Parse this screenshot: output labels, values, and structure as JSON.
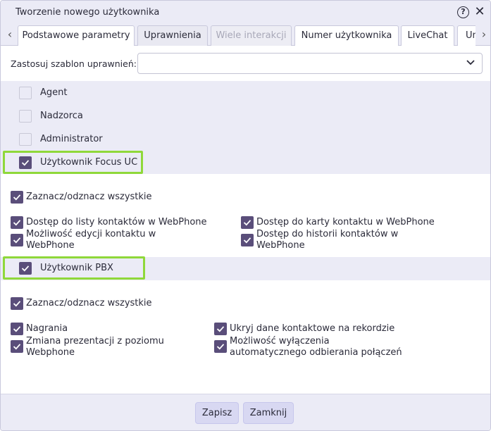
{
  "dialog": {
    "title": "Tworzenie nowego użytkownika",
    "help_icon": "help-circle-icon",
    "close_icon": "close-icon"
  },
  "tabs": [
    {
      "label": "Podstawowe parametry",
      "state": "active"
    },
    {
      "label": "Uprawnienia",
      "state": "normal"
    },
    {
      "label": "Wiele interakcji",
      "state": "disabled"
    },
    {
      "label": "Numer użytkownika",
      "state": "normal"
    },
    {
      "label": "LiveChat",
      "state": "normal"
    },
    {
      "label": "Un",
      "state": "normal"
    }
  ],
  "template": {
    "label": "Zastosuj szablon uprawnień:",
    "value": ""
  },
  "roles": [
    {
      "label": "Agent",
      "checked": false
    },
    {
      "label": "Nadzorca",
      "checked": false
    },
    {
      "label": "Administrator",
      "checked": false
    },
    {
      "label": "Użytkownik Focus UC",
      "checked": true
    }
  ],
  "focus_uc": {
    "select_all": "Zaznacz/odznacz wszystkie",
    "permissions": [
      {
        "label": "Dostęp do listy kontaktów w WebPhone",
        "checked": true
      },
      {
        "label": "Dostęp do karty kontaktu w WebPhone",
        "checked": true
      },
      {
        "label": "Możliwość edycji kontaktu w WebPhone",
        "checked": true
      },
      {
        "label": "Dostęp do historii kontaktów w WebPhone",
        "checked": true
      }
    ]
  },
  "pbx": {
    "label": "Użytkownik PBX",
    "checked": true,
    "select_all": "Zaznacz/odznacz wszystkie",
    "permissions": [
      {
        "label": "Nagrania",
        "checked": true
      },
      {
        "label": "Ukryj dane kontaktowe na rekordzie",
        "checked": true
      },
      {
        "label": "Zmiana prezentacji z poziomu Webphone",
        "checked": true
      },
      {
        "label": "Możliwość wyłączenia automatycznego odbierania połączeń",
        "checked": true
      }
    ]
  },
  "buttons": {
    "save": "Zapisz",
    "close": "Zamknij"
  },
  "colors": {
    "checkbox_checked": "#5a4e7a",
    "highlight": "#8fd83a",
    "band": "#ebebf6",
    "button": "#d8d8f2"
  }
}
